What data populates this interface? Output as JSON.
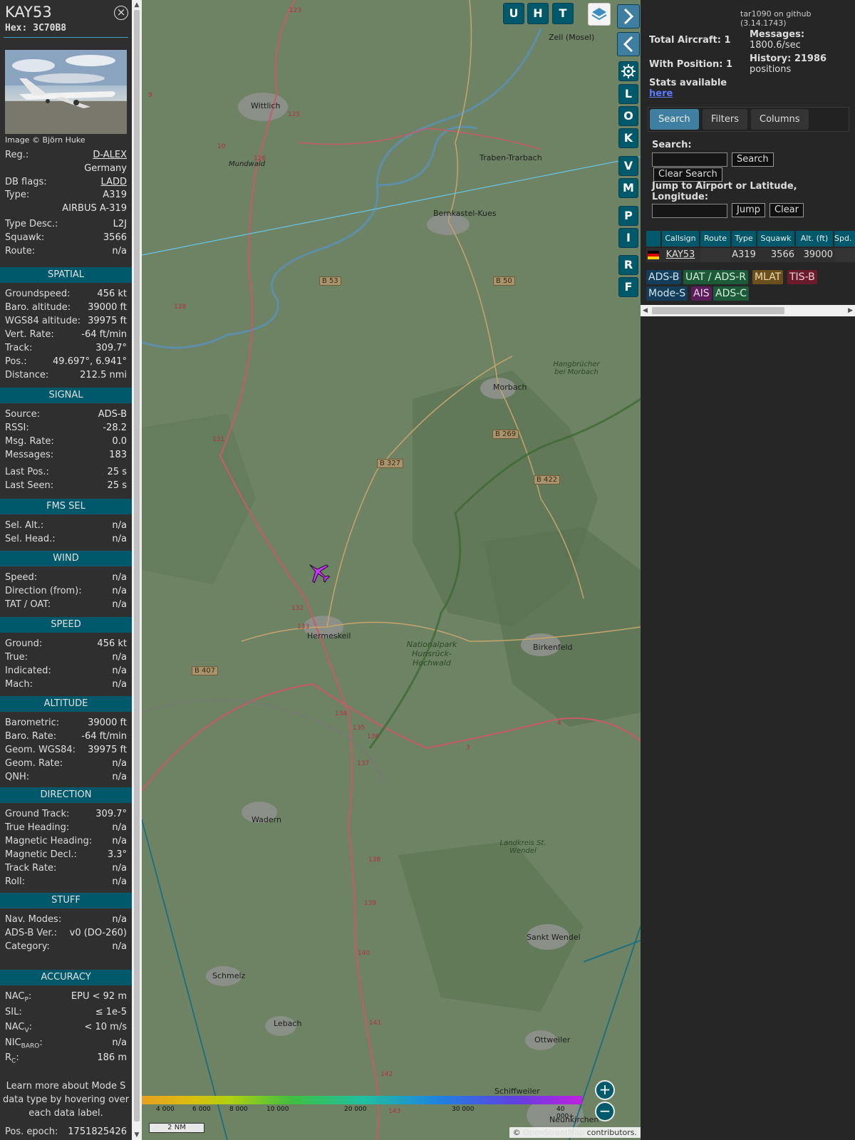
{
  "info": {
    "callsign": "KAY53",
    "hex": "Hex: 3C70B8",
    "photo_credit": "Image © Björn Huke",
    "rows_top": [
      {
        "label": "Reg.:",
        "value": "D-ALEX",
        "link": true
      },
      {
        "label": "",
        "value": "Germany"
      },
      {
        "label": "DB flags:",
        "value": "LADD",
        "link": true
      },
      {
        "label": "Type:",
        "value": "A319"
      },
      {
        "label": "",
        "value": "AIRBUS A-319"
      },
      {
        "label": "Type Desc.:",
        "value": "L2J"
      },
      {
        "label": "Squawk:",
        "value": "3566"
      },
      {
        "label": "Route:",
        "value": "n/a"
      }
    ],
    "sections": [
      {
        "title": "SPATIAL",
        "rows": [
          {
            "label": "Groundspeed:",
            "value": "456 kt"
          },
          {
            "label": "Baro. altitude:",
            "value": "39000 ft"
          },
          {
            "label": "WGS84 altitude:",
            "value": "39975 ft"
          },
          {
            "label": "Vert. Rate:",
            "value": "-64 ft/min"
          },
          {
            "label": "Track:",
            "value": "309.7°"
          },
          {
            "label": "Pos.:",
            "value": "49.697°, 6.941°"
          },
          {
            "label": "Distance:",
            "value": "212.5 nmi"
          }
        ]
      },
      {
        "title": "SIGNAL",
        "rows": [
          {
            "label": "Source:",
            "value": "ADS-B"
          },
          {
            "label": "RSSI:",
            "value": "-28.2"
          },
          {
            "label": "Msg. Rate:",
            "value": "0.0"
          },
          {
            "label": "Messages:",
            "value": "183"
          },
          {
            "label": "Last Pos.:",
            "value": "25 s"
          },
          {
            "label": "Last Seen:",
            "value": "25 s"
          }
        ]
      },
      {
        "title": "FMS SEL",
        "rows": [
          {
            "label": "Sel. Alt.:",
            "value": "n/a"
          },
          {
            "label": "Sel. Head.:",
            "value": "n/a"
          }
        ]
      },
      {
        "title": "WIND",
        "rows": [
          {
            "label": "Speed:",
            "value": "n/a"
          },
          {
            "label": "Direction (from):",
            "value": "n/a"
          },
          {
            "label": "TAT / OAT:",
            "value": "n/a"
          }
        ]
      },
      {
        "title": "SPEED",
        "rows": [
          {
            "label": "Ground:",
            "value": "456 kt"
          },
          {
            "label": "True:",
            "value": "n/a"
          },
          {
            "label": "Indicated:",
            "value": "n/a"
          },
          {
            "label": "Mach:",
            "value": "n/a"
          }
        ]
      },
      {
        "title": "ALTITUDE",
        "rows": [
          {
            "label": "Barometric:",
            "value": "39000 ft"
          },
          {
            "label": "Baro. Rate:",
            "value": "-64 ft/min"
          },
          {
            "label": "Geom. WGS84:",
            "value": "39975 ft"
          },
          {
            "label": "Geom. Rate:",
            "value": "n/a"
          },
          {
            "label": "QNH:",
            "value": "n/a"
          }
        ]
      },
      {
        "title": "DIRECTION",
        "rows": [
          {
            "label": "Ground Track:",
            "value": "309.7°"
          },
          {
            "label": "True Heading:",
            "value": "n/a"
          },
          {
            "label": "Magnetic Heading:",
            "value": "n/a"
          },
          {
            "label": "Magnetic Decl.:",
            "value": "3.3°"
          },
          {
            "label": "Track Rate:",
            "value": "n/a"
          },
          {
            "label": "Roll:",
            "value": "n/a"
          }
        ]
      },
      {
        "title": "STUFF",
        "rows": [
          {
            "label": "Nav. Modes:",
            "value": "n/a"
          },
          {
            "label": "ADS-B Ver.:",
            "value": "v0 (DO-260)"
          },
          {
            "label": "Category:",
            "value": "n/a"
          }
        ]
      },
      {
        "title": "ACCURACY",
        "rows": [
          {
            "label": "NAC",
            "sub": "P",
            "suffix": ":",
            "value": "EPU < 92 m"
          },
          {
            "label": "SIL:",
            "value": "≤ 1e-5"
          },
          {
            "label": "NAC",
            "sub": "V",
            "suffix": ":",
            "value": "< 10 m/s"
          },
          {
            "label": "NIC",
            "sub": "BARO",
            "suffix": ":",
            "value": "n/a"
          },
          {
            "label": "R",
            "sub": "C",
            "suffix": ":",
            "value": "186 m"
          }
        ]
      }
    ],
    "learn_more": "Learn more about Mode S data type by hovering over each data label.",
    "pos_epoch_label": "Pos. epoch:",
    "pos_epoch_value": "1751825426"
  },
  "map": {
    "places": [
      "Zell (Mosel)",
      "Wittlich",
      "Traben-Trarbach",
      "Bernkastel-Kues",
      "Morbach",
      "Hermeskeil",
      "Birkenfeld",
      "Wadern",
      "Sankt Wendel",
      "Schmelz",
      "Lebach",
      "Ottweiler",
      "Schiffweiler",
      "Neunkirchen",
      "Mundwald",
      "Hangbrücher bei Morbach",
      "Nationalpark Hunsrück-Hochwald",
      "Landkreis St. Wendel"
    ],
    "road_badges": [
      "B 53",
      "B 50",
      "B 269",
      "B 327",
      "B 422",
      "B 407"
    ],
    "road_numbers": [
      "123",
      "125",
      "126",
      "131",
      "128",
      "132",
      "133",
      "134",
      "135",
      "136",
      "137",
      "138",
      "139",
      "140",
      "141",
      "142",
      "143",
      "10",
      "9",
      "3",
      "4"
    ],
    "side_buttons": [
      "U",
      "H",
      "T"
    ],
    "letter_buttons": [
      "L",
      "O",
      "K",
      "V",
      "M",
      "P",
      "I",
      "R",
      "F"
    ],
    "icons": {
      "layers": "layers-icon",
      "next": "chevron-right-icon",
      "prev": "chevron-left-icon",
      "settings": "gear-icon",
      "expand": "expand-horizontal-icon",
      "aircraft": "airplane-icon"
    },
    "colorbar_ticks": [
      "4 000",
      "6 000",
      "8 000",
      "10 000",
      "20 000",
      "30 000",
      "40 000+"
    ],
    "scale_label": "2 NM",
    "attribution_prefix": "© ",
    "attribution_link": "OpenStreetMap",
    "attribution_suffix": " contributors."
  },
  "right": {
    "github_link": "tar1090 on github (3.14.1743)",
    "total_aircraft": "Total Aircraft: 1",
    "messages_label": "Messages:",
    "messages_value": "1800.6/sec",
    "with_position": "With Position: 1",
    "history_label": "History: 21986",
    "history_value": "positions",
    "stats_label": "Stats available",
    "stats_link": "here",
    "tabs": [
      "Search",
      "Filters",
      "Columns"
    ],
    "search_label": "Search:",
    "search_button": "Search",
    "clear_search_button": "Clear Search",
    "jump_label": "Jump to Airport or Latitude, Longitude:",
    "jump_button": "Jump",
    "clear_button": "Clear",
    "table_headers": [
      "Callsign",
      "Route",
      "Type",
      "Squawk",
      "Alt. (ft)",
      "Spd."
    ],
    "table_row": {
      "callsign": "KAY53",
      "route": "",
      "type": "A319",
      "squawk": "3566",
      "alt": "39000"
    },
    "source_chips": [
      "ADS-B",
      "UAT / ADS-R",
      "MLAT",
      "TIS-B",
      "Mode-S",
      "AIS",
      "ADS-C"
    ]
  },
  "colors": {
    "accent": "#00596b",
    "tab_active": "#3e7fa1",
    "aircraft": "#cc33ff"
  }
}
